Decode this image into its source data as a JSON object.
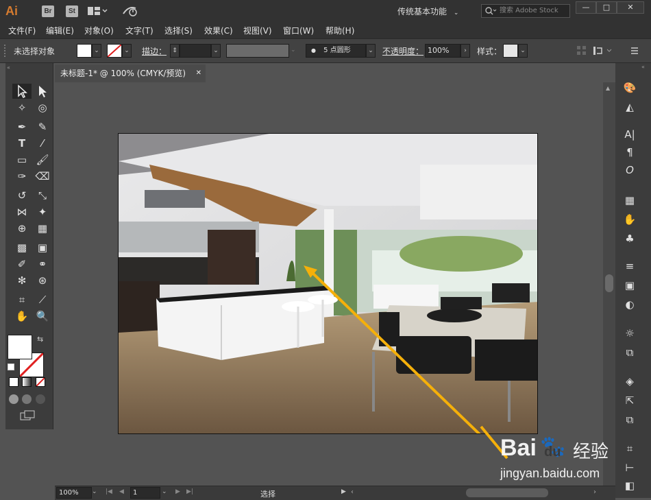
{
  "app": {
    "logo": "Ai",
    "bridge_label": "Br",
    "stock_label": "St",
    "workspace": "传统基本功能",
    "search_placeholder": "搜索 Adobe Stock",
    "win_minimize": "—",
    "win_maximize": "□",
    "win_close": "✕"
  },
  "menu": {
    "items": [
      "文件(F)",
      "编辑(E)",
      "对象(O)",
      "文字(T)",
      "选择(S)",
      "效果(C)",
      "视图(V)",
      "窗口(W)",
      "帮助(H)"
    ]
  },
  "control": {
    "no_selection": "未选择对象",
    "stroke_label": "描边：",
    "brush_dot": "●",
    "brush_label": "5 点圆形",
    "opacity_label": "不透明度：",
    "opacity_value": "100%",
    "style_label": "样式："
  },
  "document": {
    "tab_title": "未标题-1* @ 100% (CMYK/预览)",
    "close": "✕"
  },
  "status": {
    "zoom": "100%",
    "page": "1",
    "tool": "选择"
  },
  "watermark": {
    "brand": "Bai",
    "brand2": "du",
    "suffix": "经验",
    "url": "jingyan.baidu.com"
  },
  "colors": {
    "accent": "#d57b2f",
    "arrow": "#f5b00a",
    "panel": "#3c3c3c",
    "canvas": "#535353"
  }
}
